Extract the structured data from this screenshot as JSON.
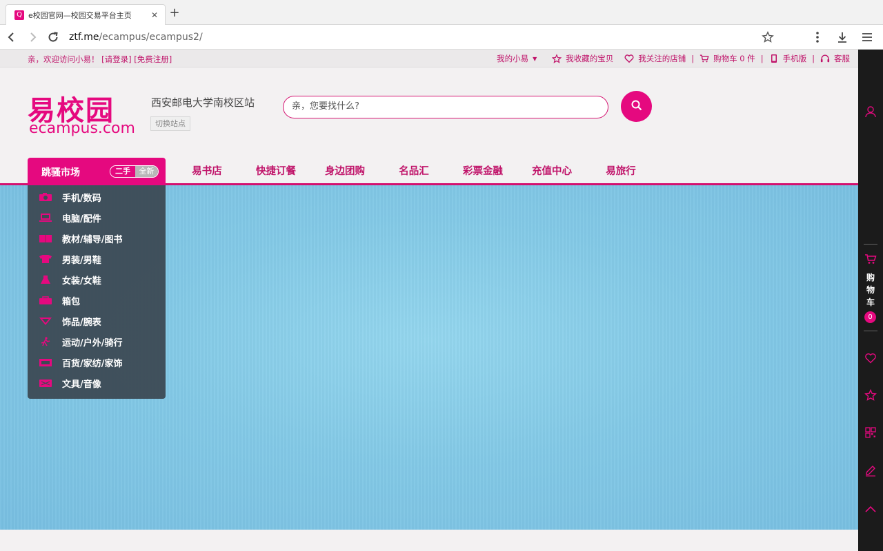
{
  "browser": {
    "tab_title": "e校园官网—校园交易平台主页",
    "favicon_letter": "Q",
    "url_host": "ztf.me",
    "url_path": "/ecampus/ecampus2/"
  },
  "topbar": {
    "greeting": "亲，欢迎访问小易！",
    "login": "[请登录]",
    "register": "[免费注册]",
    "my_account": "我的小易",
    "favorites": "我收藏的宝贝",
    "followed_shops": "我关注的店铺",
    "cart": "购物车 0 件",
    "mobile": "手机版",
    "service": "客服"
  },
  "header": {
    "logo_cn": "易校园",
    "logo_en": "ecampus.com",
    "site_name": "西安邮电大学南校区站",
    "switch_site": "切换站点",
    "search_placeholder": "亲，您要找什么?"
  },
  "nav": {
    "market_label": "跳骚市场",
    "toggle_used": "二手",
    "toggle_new": "全新",
    "items": [
      "易书店",
      "快捷订餐",
      "身边团购",
      "名品汇",
      "彩票金融",
      "充值中心",
      "易旅行"
    ]
  },
  "categories": [
    {
      "label": "手机/数码",
      "icon": "camera-icon"
    },
    {
      "label": "电脑/配件",
      "icon": "laptop-icon"
    },
    {
      "label": "教材/辅导/图书",
      "icon": "book-icon"
    },
    {
      "label": "男装/男鞋",
      "icon": "shirt-icon"
    },
    {
      "label": "女装/女鞋",
      "icon": "dress-icon"
    },
    {
      "label": "箱包",
      "icon": "bag-icon"
    },
    {
      "label": "饰品/腕表",
      "icon": "jewelry-icon"
    },
    {
      "label": "运动/户外/骑行",
      "icon": "sport-icon"
    },
    {
      "label": "百货/家纺/家饰",
      "icon": "home-icon"
    },
    {
      "label": "文具/音像",
      "icon": "stationery-icon"
    }
  ],
  "sidebar": {
    "cart_chars": [
      "购",
      "物",
      "车"
    ],
    "cart_count": "0"
  },
  "colors": {
    "brand": "#e5097f",
    "brand_dark": "#c0146a",
    "banner": "#83c9e6",
    "menu_bg": "#3c4a54"
  }
}
